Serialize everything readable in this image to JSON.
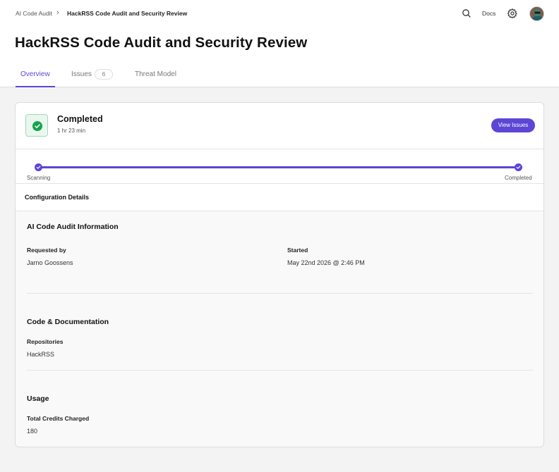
{
  "breadcrumb": {
    "parent": "AI Code Audit",
    "separator": "›",
    "current": "HackRSS Code Audit and Security Review"
  },
  "header": {
    "docs_label": "Docs"
  },
  "page": {
    "title": "HackRSS Code Audit and Security Review"
  },
  "tabs": [
    {
      "label": "Overview",
      "active": true
    },
    {
      "label": "Issues",
      "count": "6"
    },
    {
      "label": "Threat Model"
    }
  ],
  "status": {
    "title": "Completed",
    "duration": "1 hr 23 min",
    "view_button": "View Issues",
    "color": "#16a34a"
  },
  "progress": {
    "start_label": "Scanning",
    "end_label": "Completed",
    "fraction": 1.0
  },
  "config": {
    "title": "Configuration Details"
  },
  "audit_info": {
    "title": "AI Code Audit Information",
    "requested_by_label": "Requested by",
    "requested_by": "Jarno Goossens",
    "started_label": "Started",
    "started": "May 22nd 2026 @ 2:46 PM"
  },
  "code_docs": {
    "title": "Code & Documentation",
    "repos_label": "Repositories",
    "repos": "HackRSS"
  },
  "usage": {
    "title": "Usage",
    "credits_label": "Total Credits Charged",
    "credits": "180"
  },
  "colors": {
    "accent": "#5b46d6",
    "success": "#16a34a"
  }
}
